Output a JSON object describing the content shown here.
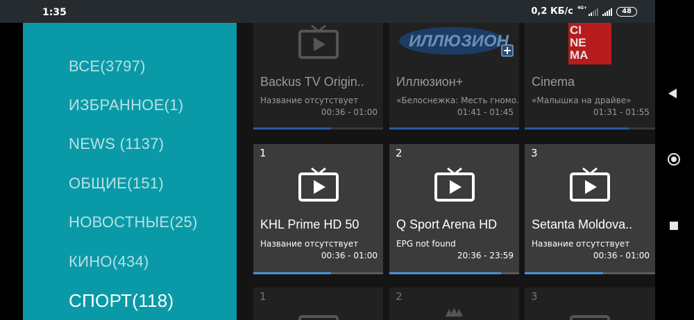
{
  "status_bar": {
    "time": "1:35",
    "network_speed": "0,2 КБ/с",
    "network_type": "4G+",
    "battery": "48"
  },
  "sidebar": {
    "categories": [
      {
        "label": "ВСЕ(3797)"
      },
      {
        "label": "ИЗБРАННОЕ(1)"
      },
      {
        "label": "NEWS (1137)"
      },
      {
        "label": "ОБЩИЕ(151)"
      },
      {
        "label": "НОВОСТНЫЕ(25)"
      },
      {
        "label": "КИНО(434)"
      },
      {
        "label": "СПОРТ(118)"
      }
    ],
    "selected": "СПОРТ(118)"
  },
  "grid": {
    "top_row": [
      {
        "name": "Backus TV Origin..",
        "program": "Название отсутствует",
        "time": "00:36 - 01:00",
        "progress": 0.6,
        "logo": "tv-icon"
      },
      {
        "name": "Иллюзион+",
        "program": "«Белоснежка: Месть гномо..",
        "time": "01:41 - 01:45",
        "progress": 1.0,
        "logo": "illusion-plus-logo",
        "logo_text": "ИЛЛЮЗИОН"
      },
      {
        "name": "Cinema",
        "program": "«Малышка на драйве»",
        "time": "01:31 - 01:55",
        "progress": 0.8,
        "logo": "cinema-logo",
        "logo_text": [
          "CI",
          "NE",
          "MA"
        ]
      }
    ],
    "middle_row": [
      {
        "number": "1",
        "name": "KHL Prime HD 50",
        "program": "Название отсутствует",
        "time": "00:36 - 01:00",
        "progress": 0.6
      },
      {
        "number": "2",
        "name": "Q Sport Arena HD",
        "program": "EPG not found",
        "time": "20:36 - 23:59",
        "progress": 0.86
      },
      {
        "number": "3",
        "name": "Setanta Moldova..",
        "program": "Название отсутствует",
        "time": "00:36 - 01:00",
        "progress": 0.6
      }
    ],
    "bottom_row": [
      {
        "number": "1"
      },
      {
        "number": "2"
      },
      {
        "number": "3"
      }
    ]
  },
  "colors": {
    "sidebar": "#0a9aa7",
    "progress": "#4a90d9",
    "card": "#212121",
    "card_focused": "#3b3b3b"
  }
}
